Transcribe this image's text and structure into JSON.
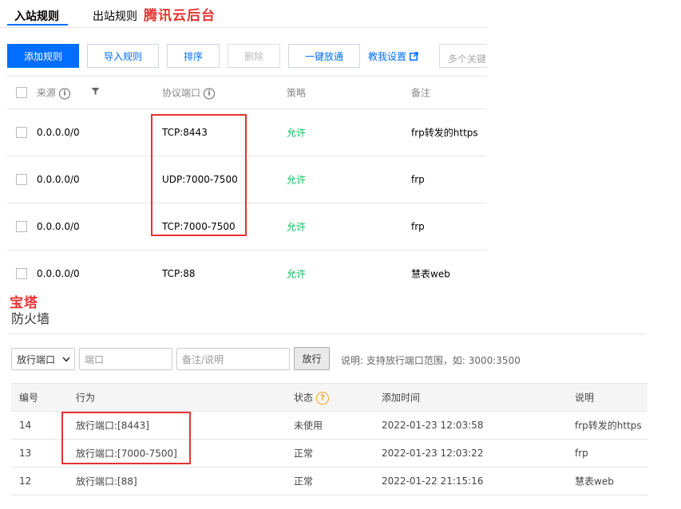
{
  "tencent": {
    "tabs": {
      "inbound": "入站规则",
      "outbound": "出站规则"
    },
    "annotation": "腾讯云后台",
    "buttons": {
      "add": "添加规则",
      "import": "导入规则",
      "sort": "排序",
      "delete": "删除",
      "allow_all": "一键放通"
    },
    "help_link": "教我设置",
    "search_placeholder": "多个关键",
    "columns": {
      "source": "来源",
      "port": "协议端口",
      "policy": "策略",
      "remark": "备注"
    },
    "rows": [
      {
        "source": "0.0.0.0/0",
        "port": "TCP:8443",
        "policy": "允许",
        "remark": "frp转发的https"
      },
      {
        "source": "0.0.0.0/0",
        "port": "UDP:7000-7500",
        "policy": "允许",
        "remark": "frp"
      },
      {
        "source": "0.0.0.0/0",
        "port": "TCP:7000-7500",
        "policy": "允许",
        "remark": "frp"
      },
      {
        "source": "0.0.0.0/0",
        "port": "TCP:88",
        "policy": "允许",
        "remark": "慧表web"
      }
    ]
  },
  "bt": {
    "annotation": "宝塔",
    "title": "防火墙",
    "select_value": "放行端口",
    "port_placeholder": "端口",
    "note_placeholder": "备注/说明",
    "submit": "放行",
    "hint": "说明: 支持放行端口范围，如: 3000:3500",
    "columns": {
      "id": "编号",
      "action": "行为",
      "status": "状态",
      "added": "添加时间",
      "note": "说明"
    },
    "rows": [
      {
        "id": "14",
        "action": "放行端口:[8443]",
        "status": "未使用",
        "added": "2022-01-23 12:03:58",
        "note": "frp转发的https"
      },
      {
        "id": "13",
        "action": "放行端口:[7000-7500]",
        "status": "正常",
        "added": "2022-01-23 12:03:22",
        "note": "frp"
      },
      {
        "id": "12",
        "action": "放行端口:[88]",
        "status": "正常",
        "added": "2022-01-22 21:15:16",
        "note": "慧表web"
      }
    ]
  },
  "colors": {
    "accent": "#006eff",
    "allow": "#0abf5b",
    "annotation": "#e53333"
  }
}
